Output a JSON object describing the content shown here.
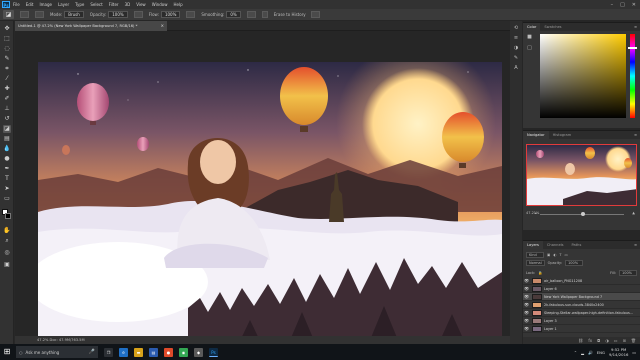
{
  "menubar": {
    "app_badge": "Ps",
    "items": [
      "File",
      "Edit",
      "Image",
      "Layer",
      "Type",
      "Select",
      "Filter",
      "3D",
      "View",
      "Window",
      "Help"
    ]
  },
  "options": {
    "mode_label": "Mode:",
    "mode_value": "Brush",
    "opacity_label": "Opacity:",
    "opacity_value": "100%",
    "flow_label": "Flow:",
    "flow_value": "100%",
    "smoothing_label": "Smoothing:",
    "smoothing_value": "0%",
    "erase_history_label": "Erase to History"
  },
  "document": {
    "tab_title": "Untitled-1 @ 47.2% (New York Wallpaper Background 7, RGB/16) *",
    "close_glyph": "×"
  },
  "status": {
    "zoom_doc": "47.2%   Doc: 47.9M/763.5M"
  },
  "color_panel": {
    "tabs": [
      "Color",
      "Swatches"
    ],
    "base_hue": "#ffcc00"
  },
  "navigator_panel": {
    "tabs": [
      "Navigator",
      "Histogram"
    ],
    "zoom": "47.21%"
  },
  "layers_panel": {
    "tabs": [
      "Layers",
      "Channels",
      "Paths"
    ],
    "kind_label": "Kind",
    "blend_mode": "Normal",
    "opacity_label": "Opacity:",
    "opacity_value": "100%",
    "lock_label": "Lock:",
    "fill_label": "Fill:",
    "fill_value": "100%",
    "layers": [
      {
        "name": "air_balloon_PNG11208",
        "selected": false,
        "thumb": "#c98a6a"
      },
      {
        "name": "Layer 6",
        "selected": false,
        "thumb": "#6a5a66"
      },
      {
        "name": "New York Wallpaper Background 7",
        "selected": true,
        "thumb": "#4a3a3a"
      },
      {
        "name": "2k-fabulous-sun-clouds-3840x2400",
        "selected": false,
        "thumb": "#e0a070"
      },
      {
        "name": "Sleeping-Stellar-wallpaper-high-definition-fabulous...",
        "selected": false,
        "thumb": "#d48a7a"
      },
      {
        "name": "Layer 3",
        "selected": false,
        "thumb": "#9a7a7a"
      },
      {
        "name": "Layer 1",
        "selected": false,
        "thumb": "#7a6a80"
      }
    ]
  },
  "taskbar": {
    "search_placeholder": "Ask me anything",
    "language": "ENG",
    "time": "9:52 PM",
    "date": "9/14/2016"
  },
  "colors": {
    "app_bg": "#282828",
    "panel_bg": "#353535",
    "selected_layer": "#4a4a4a",
    "nav_frame": "#e23b3b",
    "ps_blue": "#31a8ff"
  }
}
